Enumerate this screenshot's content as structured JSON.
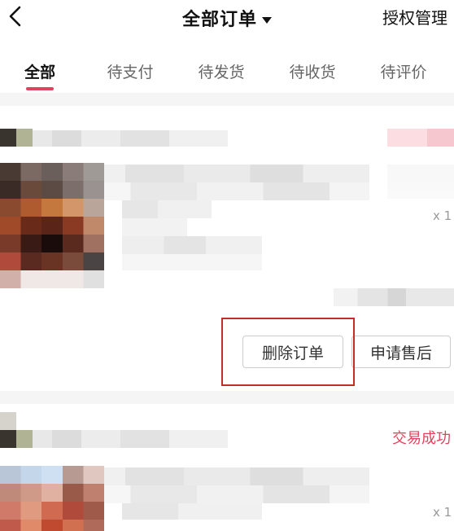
{
  "header": {
    "title": "全部订单",
    "right_action": "授权管理"
  },
  "tabs": [
    {
      "label": "全部",
      "active": true
    },
    {
      "label": "待支付"
    },
    {
      "label": "待发货"
    },
    {
      "label": "待收货"
    },
    {
      "label": "待评价"
    }
  ],
  "orders": [
    {
      "status": "",
      "quantity": "x 1",
      "actions": {
        "delete": "删除订单",
        "after_sale": "申请售后"
      }
    },
    {
      "status": "交易成功",
      "quantity": "x 1"
    }
  ],
  "colors": {
    "accent": "#e0435d",
    "highlight_box": "#c0302a"
  },
  "icons": {
    "back": "chevron-left-icon",
    "title_dropdown": "caret-down-icon"
  }
}
